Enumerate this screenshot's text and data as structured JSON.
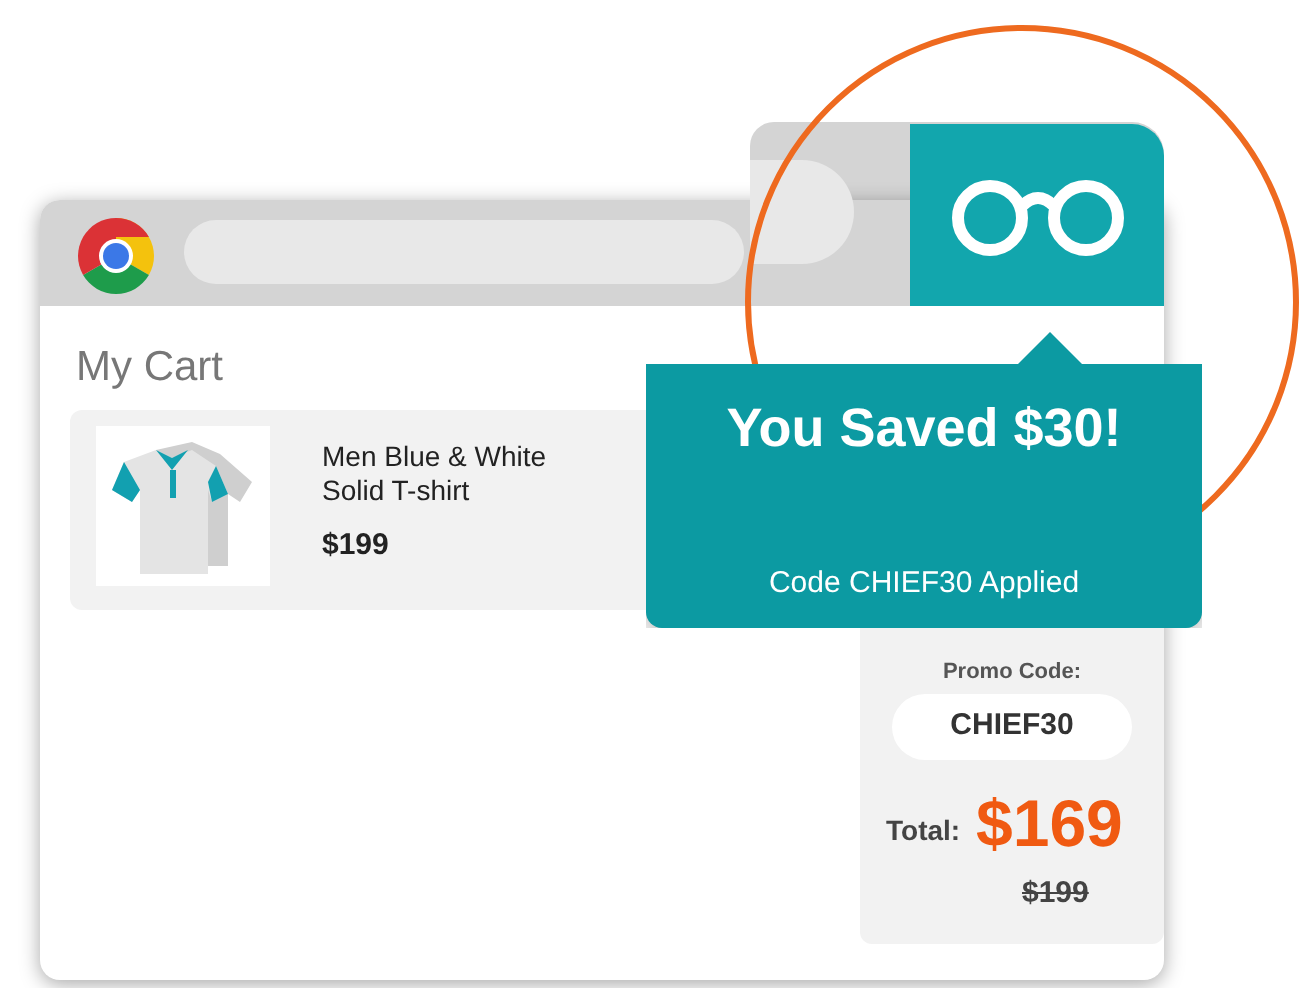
{
  "cart": {
    "title": "My Cart",
    "items": [
      {
        "name": "Men Blue & White Solid T-shirt",
        "price": "$199"
      }
    ]
  },
  "popup": {
    "headline": "You Saved $30!",
    "message": "Code CHIEF30 Applied"
  },
  "promo": {
    "label": "Promo Code:",
    "code": "CHIEF30",
    "total_label": "Total:",
    "total": "$169",
    "original_total": "$199"
  }
}
